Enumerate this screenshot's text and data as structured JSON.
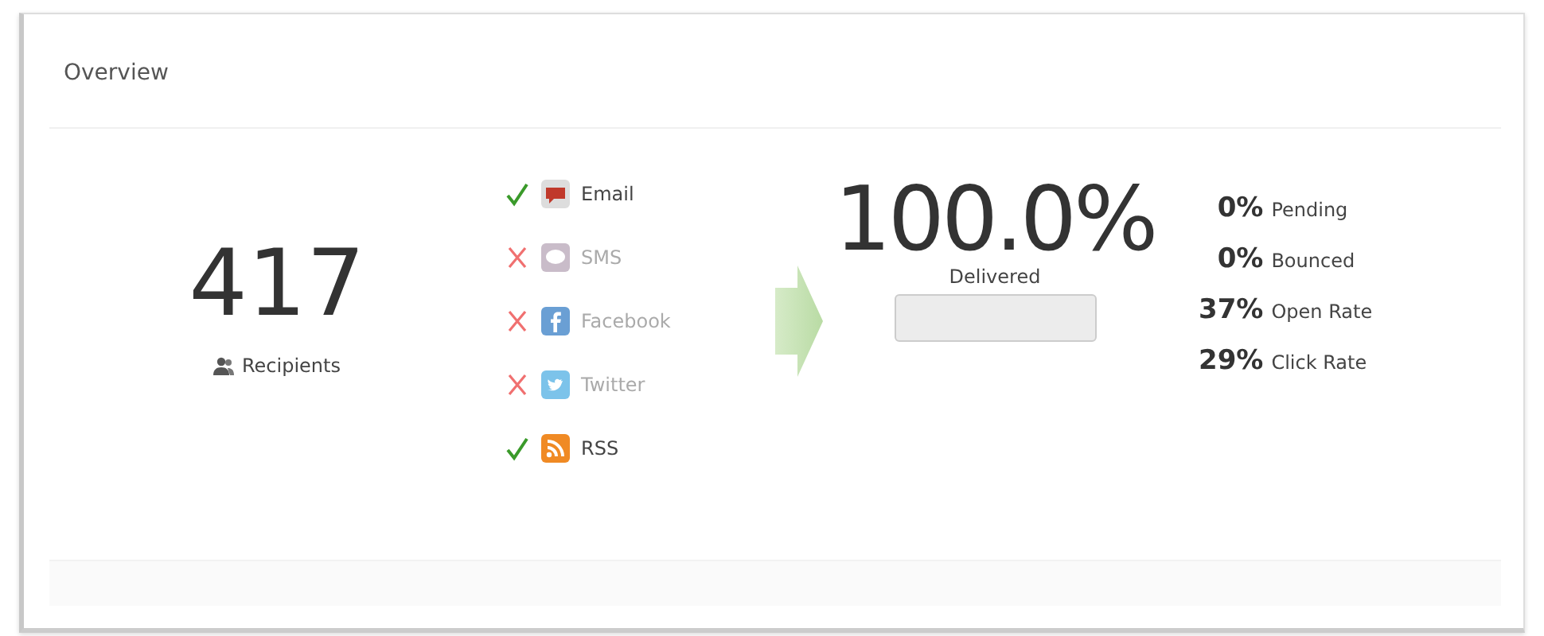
{
  "panel": {
    "title": "Overview"
  },
  "recipients": {
    "count": "417",
    "label": "Recipients"
  },
  "channels": [
    {
      "kind": "email",
      "label": "Email",
      "enabled": true
    },
    {
      "kind": "sms",
      "label": "SMS",
      "enabled": false
    },
    {
      "kind": "facebook",
      "label": "Facebook",
      "enabled": false
    },
    {
      "kind": "twitter",
      "label": "Twitter",
      "enabled": false
    },
    {
      "kind": "rss",
      "label": "RSS",
      "enabled": true
    }
  ],
  "delivery": {
    "value": "100.0%",
    "label": "Delivered",
    "level": 0
  },
  "stats": [
    {
      "value": "0%",
      "label": "Pending"
    },
    {
      "value": "0%",
      "label": "Bounced"
    },
    {
      "value": "37%",
      "label": "Open Rate"
    },
    {
      "value": "29%",
      "label": "Click Rate"
    }
  ]
}
